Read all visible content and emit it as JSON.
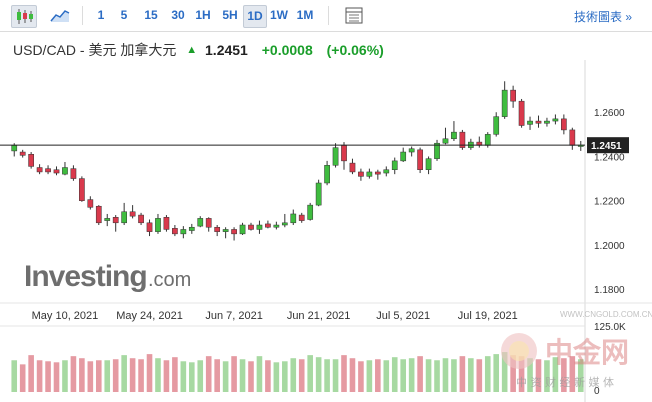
{
  "toolbar": {
    "intervals": [
      "1",
      "5",
      "15",
      "30",
      "1H",
      "5H",
      "1D",
      "1W",
      "1M"
    ],
    "active_interval": "1D",
    "tools_label": "技術圖表 »",
    "icons": [
      "candlestick-icon",
      "area-chart-icon",
      "table-icon"
    ]
  },
  "quote": {
    "name": "USD/CAD - 美元 加拿大元",
    "price": "1.2451",
    "change": "+0.0008",
    "change_pct": "(+0.06%)",
    "direction": "up"
  },
  "logo": {
    "brand": "Investing",
    "suffix": ".com"
  },
  "watermark": {
    "line1": "中金网",
    "line2": "中 资 财 经 新 媒 体",
    "url": "WWW.CNGOLD.COM.CN"
  },
  "colors": {
    "up": "#3fbc3f",
    "down": "#d9394c",
    "vol_up": "#a7d9a2",
    "vol_down": "#e59aa2",
    "accent": "#2b6cc4"
  },
  "chart_data": {
    "type": "candlestick",
    "y_axis_ticks": [
      "1.2600",
      "1.2400",
      "1.2200",
      "1.2000",
      "1.1800"
    ],
    "ylim": [
      1.176,
      1.28
    ],
    "current_price_label": "1.2451",
    "current_price": 1.2451,
    "x_axis_labels": [
      "May 10, 2021",
      "May 24, 2021",
      "Jun 7, 2021",
      "Jun 21, 2021",
      "Jul 5, 2021",
      "Jul 19, 2021"
    ],
    "x_label_index": [
      6,
      16,
      26,
      36,
      46,
      56
    ],
    "volume_axis_ticks": [
      "125.0K",
      "0"
    ],
    "candles": [
      [
        1.2425,
        1.245,
        1.24,
        1.246
      ],
      [
        1.242,
        1.2405,
        1.2395,
        1.243
      ],
      [
        1.241,
        1.2355,
        1.2345,
        1.242
      ],
      [
        1.235,
        1.233,
        1.232,
        1.2365
      ],
      [
        1.2345,
        1.233,
        1.232,
        1.236
      ],
      [
        1.234,
        1.2325,
        1.2315,
        1.2355
      ],
      [
        1.232,
        1.235,
        1.2315,
        1.2375
      ],
      [
        1.2345,
        1.23,
        1.229,
        1.236
      ],
      [
        1.23,
        1.22,
        1.2195,
        1.231
      ],
      [
        1.2205,
        1.217,
        1.216,
        1.222
      ],
      [
        1.2175,
        1.21,
        1.209,
        1.218
      ],
      [
        1.211,
        1.212,
        1.2085,
        1.214
      ],
      [
        1.2125,
        1.21,
        1.206,
        1.2135
      ],
      [
        1.21,
        1.215,
        1.209,
        1.219
      ],
      [
        1.215,
        1.213,
        1.212,
        1.218
      ],
      [
        1.2135,
        1.21,
        1.209,
        1.2145
      ],
      [
        1.21,
        1.206,
        1.204,
        1.2115
      ],
      [
        1.206,
        1.212,
        1.205,
        1.214
      ],
      [
        1.2125,
        1.207,
        1.206,
        1.2135
      ],
      [
        1.2075,
        1.205,
        1.204,
        1.209
      ],
      [
        1.205,
        1.207,
        1.203,
        1.2085
      ],
      [
        1.2065,
        1.208,
        1.205,
        1.2095
      ],
      [
        1.2085,
        1.212,
        1.208,
        1.213
      ],
      [
        1.212,
        1.208,
        1.206,
        1.2125
      ],
      [
        1.208,
        1.206,
        1.204,
        1.209
      ],
      [
        1.206,
        1.207,
        1.203,
        1.208
      ],
      [
        1.207,
        1.205,
        1.202,
        1.208
      ],
      [
        1.205,
        1.209,
        1.2045,
        1.21
      ],
      [
        1.209,
        1.207,
        1.2065,
        1.21
      ],
      [
        1.207,
        1.209,
        1.205,
        1.211
      ],
      [
        1.2095,
        1.208,
        1.2075,
        1.211
      ],
      [
        1.208,
        1.209,
        1.207,
        1.2105
      ],
      [
        1.209,
        1.21,
        1.208,
        1.214
      ],
      [
        1.21,
        1.214,
        1.209,
        1.216
      ],
      [
        1.2135,
        1.211,
        1.21,
        1.2145
      ],
      [
        1.2115,
        1.218,
        1.211,
        1.219
      ],
      [
        1.218,
        1.228,
        1.2175,
        1.2295
      ],
      [
        1.228,
        1.236,
        1.227,
        1.238
      ],
      [
        1.236,
        1.244,
        1.235,
        1.246
      ],
      [
        1.245,
        1.238,
        1.234,
        1.2465
      ],
      [
        1.237,
        1.233,
        1.232,
        1.239
      ],
      [
        1.233,
        1.231,
        1.229,
        1.2345
      ],
      [
        1.231,
        1.233,
        1.23,
        1.2345
      ],
      [
        1.233,
        1.232,
        1.2295,
        1.234
      ],
      [
        1.2325,
        1.234,
        1.231,
        1.2355
      ],
      [
        1.234,
        1.238,
        1.232,
        1.2395
      ],
      [
        1.238,
        1.242,
        1.2375,
        1.244
      ],
      [
        1.242,
        1.2435,
        1.24,
        1.2445
      ],
      [
        1.243,
        1.234,
        1.2325,
        1.244
      ],
      [
        1.234,
        1.239,
        1.232,
        1.24
      ],
      [
        1.239,
        1.246,
        1.238,
        1.2475
      ],
      [
        1.246,
        1.248,
        1.2455,
        1.253
      ],
      [
        1.248,
        1.251,
        1.247,
        1.256
      ],
      [
        1.251,
        1.244,
        1.243,
        1.252
      ],
      [
        1.244,
        1.2465,
        1.243,
        1.248
      ],
      [
        1.2465,
        1.245,
        1.244,
        1.249
      ],
      [
        1.245,
        1.25,
        1.244,
        1.251
      ],
      [
        1.25,
        1.258,
        1.249,
        1.26
      ],
      [
        1.258,
        1.27,
        1.257,
        1.274
      ],
      [
        1.27,
        1.265,
        1.262,
        1.272
      ],
      [
        1.265,
        1.254,
        1.253,
        1.266
      ],
      [
        1.2545,
        1.256,
        1.252,
        1.258
      ],
      [
        1.256,
        1.255,
        1.253,
        1.2585
      ],
      [
        1.255,
        1.256,
        1.2535,
        1.2575
      ],
      [
        1.256,
        1.257,
        1.2545,
        1.259
      ],
      [
        1.257,
        1.252,
        1.25,
        1.259
      ],
      [
        1.252,
        1.245,
        1.243,
        1.253
      ],
      [
        1.2445,
        1.2451,
        1.2425,
        1.247
      ]
    ],
    "volumes": [
      62,
      54,
      72,
      62,
      60,
      58,
      62,
      70,
      66,
      60,
      62,
      62,
      64,
      72,
      66,
      64,
      74,
      66,
      62,
      68,
      60,
      58,
      62,
      70,
      64,
      60,
      70,
      64,
      60,
      70,
      62,
      58,
      60,
      66,
      64,
      72,
      68,
      64,
      64,
      72,
      66,
      60,
      62,
      64,
      62,
      68,
      64,
      66,
      70,
      64,
      62,
      66,
      64,
      70,
      66,
      64,
      70,
      74,
      78,
      72,
      70,
      66,
      64,
      62,
      68,
      66,
      70,
      64
    ]
  }
}
